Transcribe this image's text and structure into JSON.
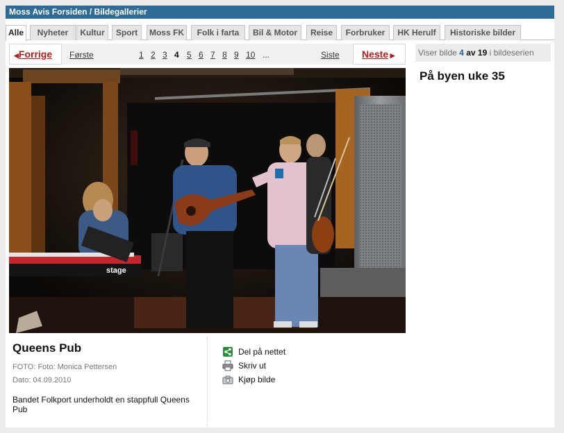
{
  "breadcrumb": {
    "home": "Moss Avis Forsiden",
    "sep": " / ",
    "current": "Bildegallerier"
  },
  "tabs": [
    "Alle",
    "Nyheter",
    "Kultur",
    "Sport",
    "Moss FK",
    "Folk i farta",
    "Bil & Motor",
    "Reise",
    "Forbruker",
    "HK Herulf",
    "Historiske bilder"
  ],
  "active_tab": "Alle",
  "pager": {
    "prev": "Forrige",
    "first": "Første",
    "pages": [
      "1",
      "2",
      "3",
      "4",
      "5",
      "6",
      "7",
      "8",
      "9",
      "10"
    ],
    "current_page": "4",
    "ellipsis": "...",
    "last": "Siste",
    "next": "Neste"
  },
  "counter": {
    "prefix": "Viser bilde",
    "current": "4",
    "of": "av",
    "total": "19",
    "suffix": "i bildeserien"
  },
  "series_title": "På byen uke 35",
  "photo": {
    "keyboard_brand": "stage",
    "alt": "Queens Pub"
  },
  "caption": {
    "title": "Queens Pub",
    "photo_credit": "FOTO: Foto: Monica Pettersen",
    "date": "Dato: 04.09.2010",
    "description": "Bandet Folkport underholdt en stappfull Queens Pub"
  },
  "actions": [
    {
      "label": "Del på nettet",
      "icon": "share-icon"
    },
    {
      "label": "Skriv ut",
      "icon": "printer-icon"
    },
    {
      "label": "Kjøp bilde",
      "icon": "buy-photo-icon"
    }
  ],
  "colors": {
    "header_blue": "#2e6c97",
    "accent_red": "#b31b1b",
    "counter_blue": "#1f5f95"
  }
}
